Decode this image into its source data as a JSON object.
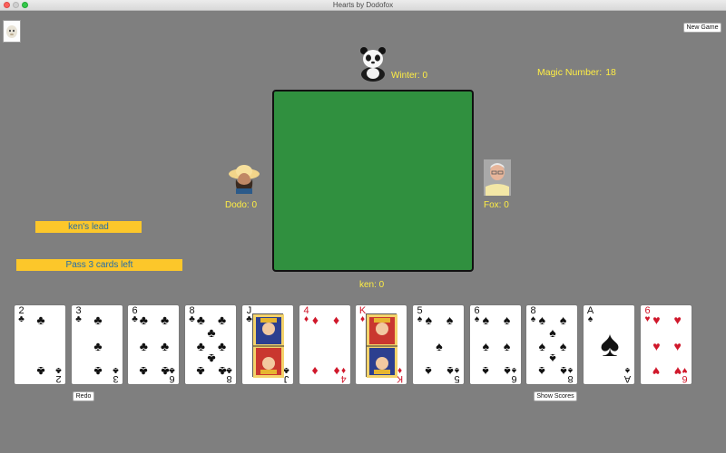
{
  "window": {
    "title": "Hearts by Dodofox"
  },
  "buttons": {
    "new_game": "New Game",
    "redo": "Redo",
    "show_scores": "Show Scores"
  },
  "players": {
    "north": {
      "label": "Winter: 0"
    },
    "west": {
      "label": "Dodo: 0"
    },
    "east": {
      "label": "Fox: 0"
    },
    "south": {
      "label": "ken: 0"
    }
  },
  "magic": {
    "label": "Magic Number:",
    "value": "18"
  },
  "status": {
    "lead": "ken's lead",
    "pass": "Pass 3 cards left"
  },
  "colors": {
    "felt": "#30903f",
    "background": "#7f7f7f",
    "banner": "#fcc72a",
    "banner_text": "#226ca9",
    "name_text": "#ffee44"
  },
  "hand": [
    {
      "rank": "2",
      "suit": "clubs",
      "symbol": "♣",
      "color": "black"
    },
    {
      "rank": "3",
      "suit": "clubs",
      "symbol": "♣",
      "color": "black"
    },
    {
      "rank": "6",
      "suit": "clubs",
      "symbol": "♣",
      "color": "black"
    },
    {
      "rank": "8",
      "suit": "clubs",
      "symbol": "♣",
      "color": "black"
    },
    {
      "rank": "J",
      "suit": "clubs",
      "symbol": "♣",
      "color": "black"
    },
    {
      "rank": "4",
      "suit": "diamonds",
      "symbol": "♦",
      "color": "red"
    },
    {
      "rank": "K",
      "suit": "diamonds",
      "symbol": "♦",
      "color": "red"
    },
    {
      "rank": "5",
      "suit": "spades",
      "symbol": "♠",
      "color": "black"
    },
    {
      "rank": "6",
      "suit": "spades",
      "symbol": "♠",
      "color": "black"
    },
    {
      "rank": "8",
      "suit": "spades",
      "symbol": "♠",
      "color": "black"
    },
    {
      "rank": "A",
      "suit": "spades",
      "symbol": "♠",
      "color": "black"
    },
    {
      "rank": "6",
      "suit": "hearts",
      "symbol": "♥",
      "color": "red"
    }
  ]
}
